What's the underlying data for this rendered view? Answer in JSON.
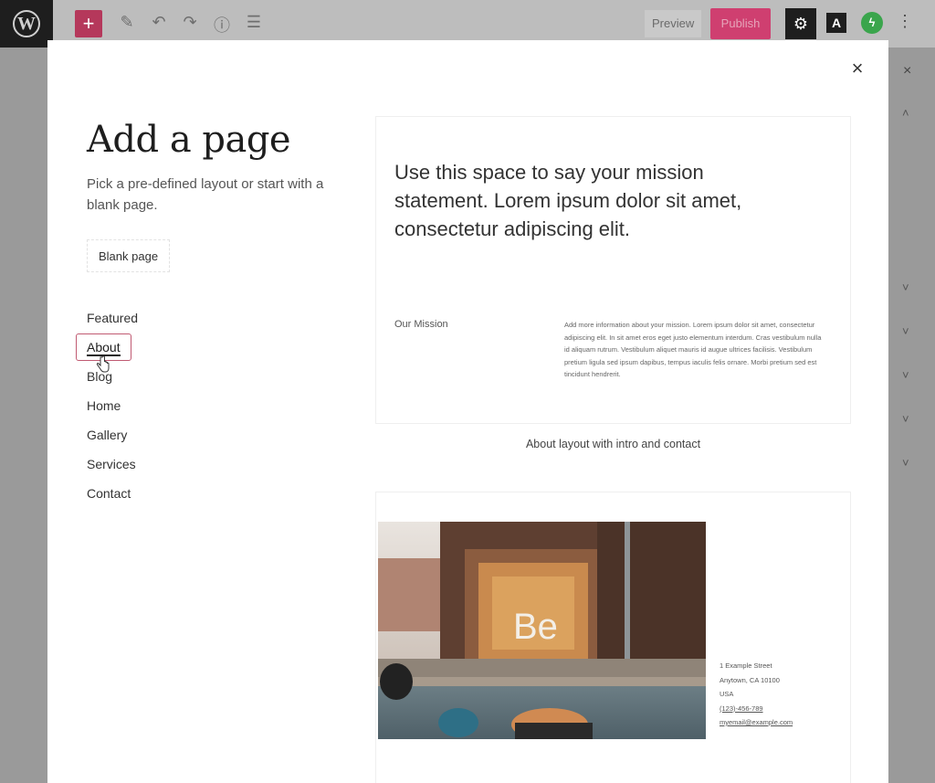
{
  "toolbar": {
    "logo_letter": "W",
    "add_symbol": "+",
    "pen_symbol": "✎",
    "undo_symbol": "↶",
    "redo_symbol": "↷",
    "info_symbol": "ⓘ",
    "outline_symbol": "☰",
    "preview_label": "Preview",
    "publish_label": "Publish",
    "settings_symbol": "⚙",
    "a_label": "A",
    "jetpack_symbol": "ϟ",
    "more_symbol": "⋮"
  },
  "sidebar_bg": {
    "close_symbol": "×",
    "up_chevron": "˄",
    "down_chevron": "˅"
  },
  "modal": {
    "close_symbol": "×",
    "title": "Add a page",
    "description": "Pick a pre-defined layout or start with a blank page.",
    "blank_page_label": "Blank page",
    "categories": [
      {
        "label": "Featured"
      },
      {
        "label": "About"
      },
      {
        "label": "Blog"
      },
      {
        "label": "Home"
      },
      {
        "label": "Gallery"
      },
      {
        "label": "Services"
      },
      {
        "label": "Contact"
      }
    ],
    "active_category": "About"
  },
  "layouts": [
    {
      "mission": "Use this space to say your mission statement. Lorem ipsum dolor sit amet, consectetur adipiscing elit.",
      "section_label": "Our Mission",
      "body": "Add more information about your mission. Lorem ipsum dolor sit amet, consectetur adipiscing elit. In sit amet eros eget justo elementum interdum. Cras vestibulum nulla id aliquam rutrum. Vestibulum aliquet mauris id augue ultrices facilisis. Vestibulum pretium ligula sed ipsum dapibus, tempus iaculis felis ornare. Morbi pretium sed est tincidunt hendrerit.",
      "caption": "About layout with intro and contact"
    },
    {
      "photo_sign": "Be",
      "address": [
        "1 Example Street",
        "Anytown, CA 10100",
        "USA",
        "(123)-456-789",
        "myemail@example.com"
      ]
    }
  ],
  "colors": {
    "accent": "#c05a72",
    "publish": "#cf3f70",
    "add": "#b5385b"
  }
}
